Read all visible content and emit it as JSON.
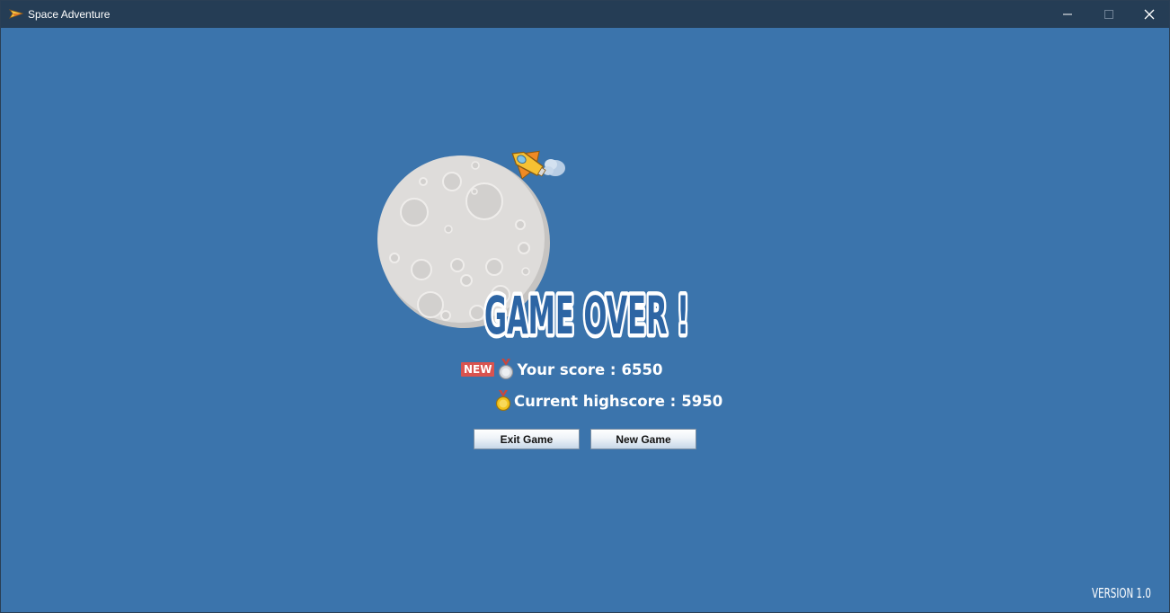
{
  "window": {
    "title": "Space Adventure",
    "icon": "paper-plane-icon",
    "controls": [
      "minimize-icon",
      "maximize-icon",
      "close-icon"
    ]
  },
  "game": {
    "headline": "GAME OVER !",
    "new_badge": "NEW",
    "your_score_label": "Your score :",
    "your_score": "6550",
    "highscore_label": "Current highscore :",
    "highscore": "5950"
  },
  "buttons": {
    "exit_label": "Exit Game",
    "new_label": "New Game"
  },
  "footer": {
    "version": "VERSION 1.0"
  },
  "colors": {
    "background": "#3b74ac",
    "titlebar": "#253d55",
    "headline_fill": "#2d65a4",
    "headline_outline": "#ffffff",
    "new_badge": "#d9534f"
  }
}
